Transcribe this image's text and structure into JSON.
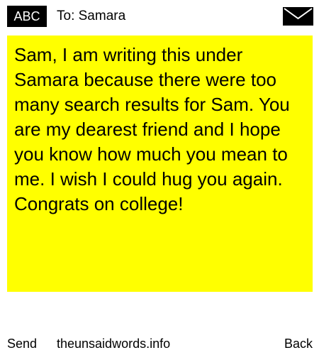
{
  "header": {
    "badge_label": "ABC",
    "to_label": "To: Samara",
    "compose_icon": "envelope-icon"
  },
  "message": {
    "text": "Sam, I am writing this under Samara because there were too many search results for Sam. You are my dearest friend and I hope you know how much you mean to me. I wish I could hug you again. Congrats on college!"
  },
  "footer": {
    "send_label": "Send",
    "site_label": "theunsaidwords.info",
    "back_label": "Back"
  },
  "colors": {
    "card_background": "#ffff00",
    "badge_background": "#000000",
    "text": "#000000",
    "page_background": "#ffffff"
  }
}
